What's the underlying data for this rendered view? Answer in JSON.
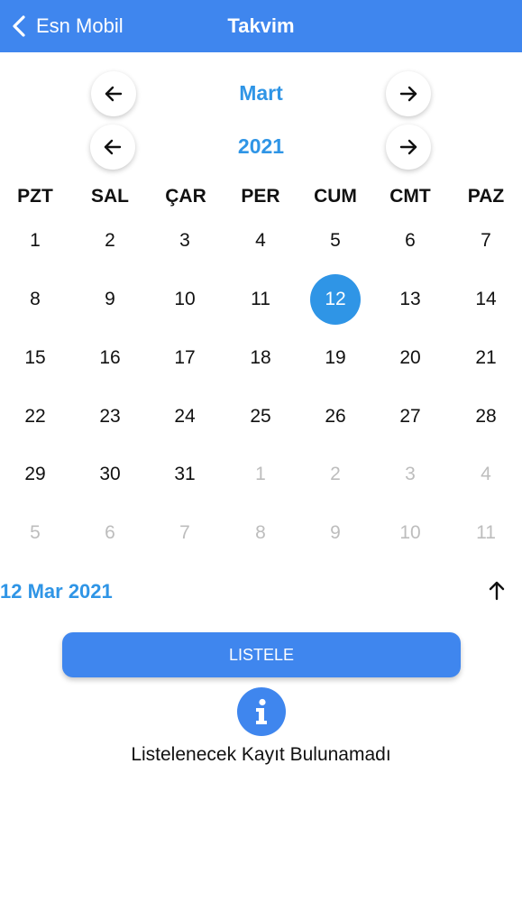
{
  "navbar": {
    "back_label": "Esn Mobil",
    "title": "Takvim",
    "background": "#3f86ee"
  },
  "month_picker": {
    "label": "Mart",
    "prev_icon": "arrow-left-icon",
    "next_icon": "arrow-right-icon"
  },
  "year_picker": {
    "label": "2021",
    "prev_icon": "arrow-left-icon",
    "next_icon": "arrow-right-icon"
  },
  "calendar": {
    "weekdays": [
      "PZT",
      "SAL",
      "ÇAR",
      "PER",
      "CUM",
      "CMT",
      "PAZ"
    ],
    "selected_day": "12",
    "weeks": [
      [
        {
          "day": "1",
          "current": true
        },
        {
          "day": "2",
          "current": true
        },
        {
          "day": "3",
          "current": true
        },
        {
          "day": "4",
          "current": true
        },
        {
          "day": "5",
          "current": true
        },
        {
          "day": "6",
          "current": true
        },
        {
          "day": "7",
          "current": true
        }
      ],
      [
        {
          "day": "8",
          "current": true
        },
        {
          "day": "9",
          "current": true
        },
        {
          "day": "10",
          "current": true
        },
        {
          "day": "11",
          "current": true
        },
        {
          "day": "12",
          "current": true
        },
        {
          "day": "13",
          "current": true
        },
        {
          "day": "14",
          "current": true
        }
      ],
      [
        {
          "day": "15",
          "current": true
        },
        {
          "day": "16",
          "current": true
        },
        {
          "day": "17",
          "current": true
        },
        {
          "day": "18",
          "current": true
        },
        {
          "day": "19",
          "current": true
        },
        {
          "day": "20",
          "current": true
        },
        {
          "day": "21",
          "current": true
        }
      ],
      [
        {
          "day": "22",
          "current": true
        },
        {
          "day": "23",
          "current": true
        },
        {
          "day": "24",
          "current": true
        },
        {
          "day": "25",
          "current": true
        },
        {
          "day": "26",
          "current": true
        },
        {
          "day": "27",
          "current": true
        },
        {
          "day": "28",
          "current": true
        }
      ],
      [
        {
          "day": "29",
          "current": true
        },
        {
          "day": "30",
          "current": true
        },
        {
          "day": "31",
          "current": true
        },
        {
          "day": "1",
          "current": false
        },
        {
          "day": "2",
          "current": false
        },
        {
          "day": "3",
          "current": false
        },
        {
          "day": "4",
          "current": false
        }
      ],
      [
        {
          "day": "5",
          "current": false
        },
        {
          "day": "6",
          "current": false
        },
        {
          "day": "7",
          "current": false
        },
        {
          "day": "8",
          "current": false
        },
        {
          "day": "9",
          "current": false
        },
        {
          "day": "10",
          "current": false
        },
        {
          "day": "11",
          "current": false
        }
      ]
    ],
    "accent_color": "#2f95e6"
  },
  "selection": {
    "date_label": "12 Mar 2021",
    "collapse_icon": "arrow-up-icon"
  },
  "actions": {
    "list_button_label": "LISTELE"
  },
  "empty_state": {
    "icon": "info-icon",
    "message": "Listelenecek Kayıt Bulunamadı"
  }
}
